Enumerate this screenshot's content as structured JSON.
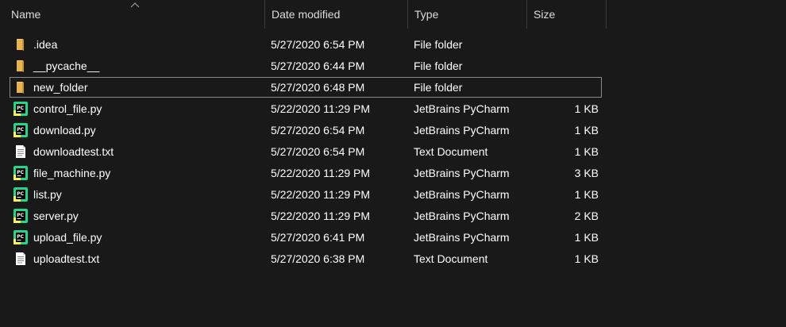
{
  "columns": {
    "name": "Name",
    "date_modified": "Date modified",
    "type": "Type",
    "size": "Size"
  },
  "colors": {
    "background": "#191919",
    "folder": "#E8B54A",
    "pycharm_green": "#21D789",
    "pycharm_black": "#000000"
  },
  "files": [
    {
      "name": ".idea",
      "date": "5/27/2020 6:54 PM",
      "type": "File folder",
      "size": "",
      "icon": "folder-icon"
    },
    {
      "name": "__pycache__",
      "date": "5/27/2020 6:44 PM",
      "type": "File folder",
      "size": "",
      "icon": "folder-icon"
    },
    {
      "name": "new_folder",
      "date": "5/27/2020 6:48 PM",
      "type": "File folder",
      "size": "",
      "icon": "folder-icon"
    },
    {
      "name": "control_file.py",
      "date": "5/22/2020 11:29 PM",
      "type": "JetBrains PyCharm",
      "size": "1 KB",
      "icon": "pycharm-icon"
    },
    {
      "name": "download.py",
      "date": "5/27/2020 6:54 PM",
      "type": "JetBrains PyCharm",
      "size": "1 KB",
      "icon": "pycharm-icon"
    },
    {
      "name": "downloadtest.txt",
      "date": "5/27/2020 6:54 PM",
      "type": "Text Document",
      "size": "1 KB",
      "icon": "text-document-icon"
    },
    {
      "name": "file_machine.py",
      "date": "5/22/2020 11:29 PM",
      "type": "JetBrains PyCharm",
      "size": "3 KB",
      "icon": "pycharm-icon"
    },
    {
      "name": "list.py",
      "date": "5/22/2020 11:29 PM",
      "type": "JetBrains PyCharm",
      "size": "1 KB",
      "icon": "pycharm-icon"
    },
    {
      "name": "server.py",
      "date": "5/22/2020 11:29 PM",
      "type": "JetBrains PyCharm",
      "size": "2 KB",
      "icon": "pycharm-icon"
    },
    {
      "name": "upload_file.py",
      "date": "5/27/2020 6:41 PM",
      "type": "JetBrains PyCharm",
      "size": "1 KB",
      "icon": "pycharm-icon"
    },
    {
      "name": "uploadtest.txt",
      "date": "5/27/2020 6:38 PM",
      "type": "Text Document",
      "size": "1 KB",
      "icon": "text-document-icon"
    }
  ]
}
